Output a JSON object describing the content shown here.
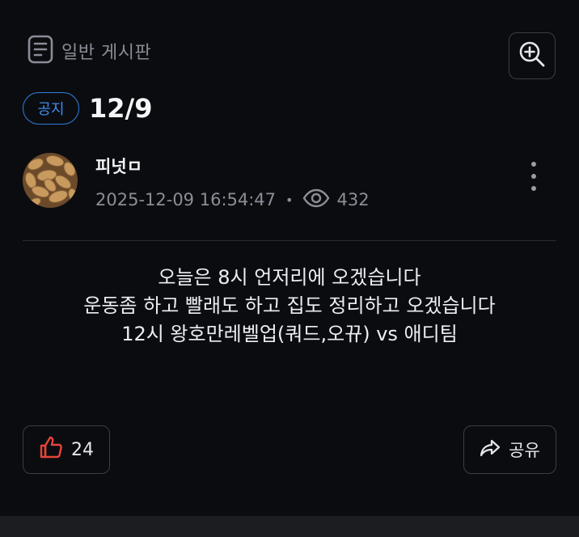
{
  "board": {
    "icon": "document-list-icon",
    "name": "일반 게시판"
  },
  "toolbar": {
    "zoom_icon": "zoom-in-icon"
  },
  "post": {
    "badge": "공지",
    "title": "12/9",
    "author": "피넛ㅁ",
    "timestamp": "2025-12-09 16:54:47",
    "separator": "•",
    "views": "432",
    "content": [
      "오늘은 8시 언저리에 오겠습니다",
      "운동좀 하고 빨래도 하고 집도 정리하고 오겠습니다",
      "12시 왕호만레벨업(쿼드,오뀨) vs 애디팀"
    ]
  },
  "actions": {
    "like_count": "24",
    "share_label": "공유"
  },
  "colors": {
    "background": "#0b0c10",
    "badge_blue": "#2f7fe0",
    "like_red": "#e8443a",
    "border": "#3b3e46"
  }
}
